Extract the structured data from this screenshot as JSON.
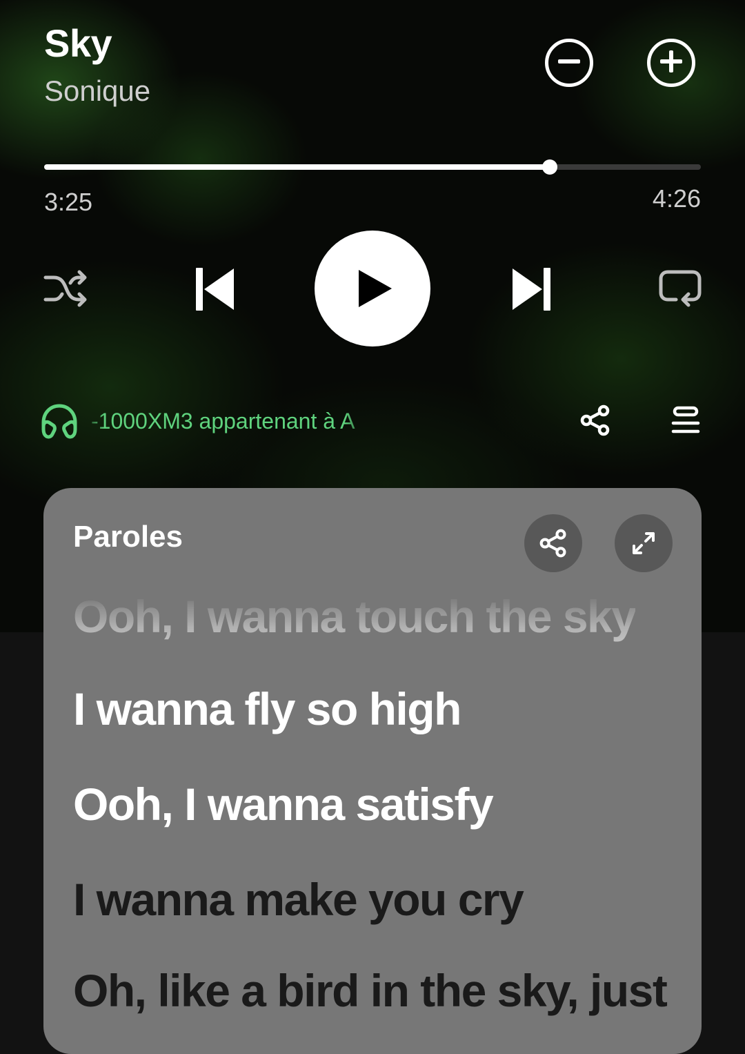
{
  "track": {
    "title": "Sky",
    "artist": "Sonique"
  },
  "playback": {
    "elapsed": "3:25",
    "duration": "4:26",
    "progress_fraction": 0.77
  },
  "device": {
    "label": "-1000XM3 appartenant à A",
    "icon": "headphones-icon",
    "color": "#5fd37e"
  },
  "lyrics": {
    "title": "Paroles",
    "lines": [
      {
        "text": "Ooh, I wanna touch the sky",
        "state": "faded"
      },
      {
        "text": "I wanna fly so high",
        "state": "past"
      },
      {
        "text": "Ooh, I wanna satisfy",
        "state": "past"
      },
      {
        "text": "I wanna make you cry",
        "state": "future"
      },
      {
        "text": "Oh, like a bird in the sky, just",
        "state": "future"
      }
    ],
    "card_color": "#777777"
  },
  "icons": {
    "remove": "minus-circle-icon",
    "add": "plus-circle-icon",
    "shuffle": "shuffle-icon",
    "previous": "skip-previous-icon",
    "play": "play-icon",
    "next": "skip-next-icon",
    "repeat": "repeat-icon",
    "share": "share-icon",
    "queue": "queue-icon",
    "expand": "expand-icon"
  }
}
